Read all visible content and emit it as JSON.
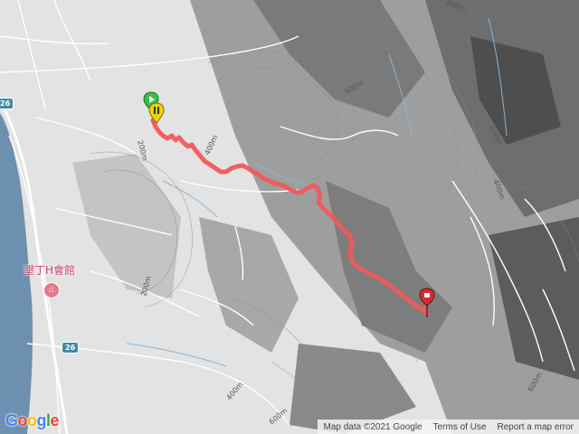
{
  "map": {
    "contour_labels": [
      "400m",
      "600m",
      "600m",
      "400m",
      "200m",
      "200m",
      "400m",
      "600m",
      "400m",
      "600m"
    ],
    "road_badges": [
      "26",
      "26"
    ],
    "poi": {
      "icon": "hotel-icon",
      "label": "墾丁H會館",
      "color": "#e8788c"
    },
    "track_color": "#f05a5a",
    "start_marker": {
      "icon": "play-icon",
      "color": "#36c04a"
    },
    "pause_marker": {
      "icon": "pause-icon",
      "color": "#f2d200"
    },
    "end_marker": {
      "icon": "pin-icon",
      "color": "#d32f2f"
    },
    "logo": [
      "G",
      "o",
      "o",
      "g",
      "l",
      "e"
    ],
    "attribution": {
      "data": "Map data ©2021 Google",
      "terms": "Terms of Use",
      "report": "Report a map error"
    }
  }
}
